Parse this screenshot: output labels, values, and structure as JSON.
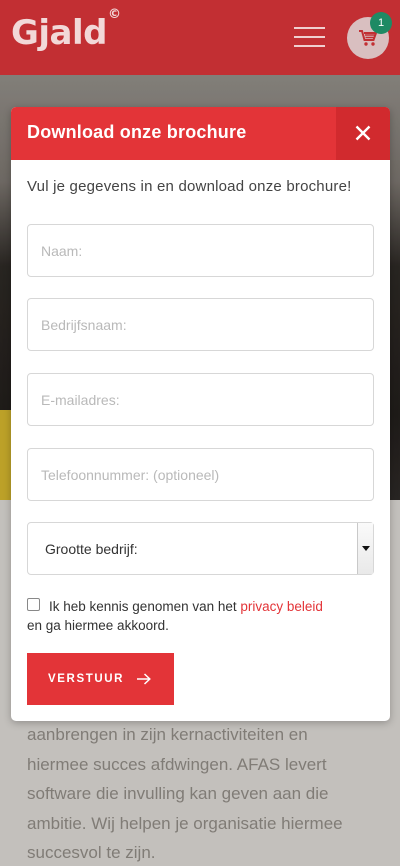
{
  "header": {
    "logo_text": "Gjald",
    "logo_mark": "©",
    "menu_icon": "hamburger-icon",
    "cart_icon": "cart-icon",
    "cart_count": "1"
  },
  "background": {
    "body_lines": [
      "aanbrengen in zijn kernactiviteiten en",
      "hiermee succes afdwingen.  AFAS levert",
      "software die invulling kan geven aan die",
      "ambitie. Wij helpen je organisatie hiermee",
      "succesvol te zijn."
    ]
  },
  "modal": {
    "title": "Download onze brochure",
    "close_icon": "close-icon",
    "intro": "Vul je gegevens in en download onze brochure!",
    "fields": {
      "name_placeholder": "Naam:",
      "company_placeholder": "Bedrijfsnaam:",
      "email_placeholder": "E-mailadres:",
      "phone_placeholder": "Telefoonnummer: (optioneel)"
    },
    "company_size": {
      "label": "Grootte bedrijf:"
    },
    "consent": {
      "prefix": "Ik heb kennis genomen van het ",
      "link": "privacy beleid",
      "suffix": "en ga hiermee akkoord."
    },
    "submit": {
      "label": "VERSTUUR",
      "icon": "arrow-right-icon"
    }
  },
  "colors": {
    "brand_red": "#e33438",
    "header_red": "#c22f33",
    "badge_green": "#1e8a64"
  }
}
